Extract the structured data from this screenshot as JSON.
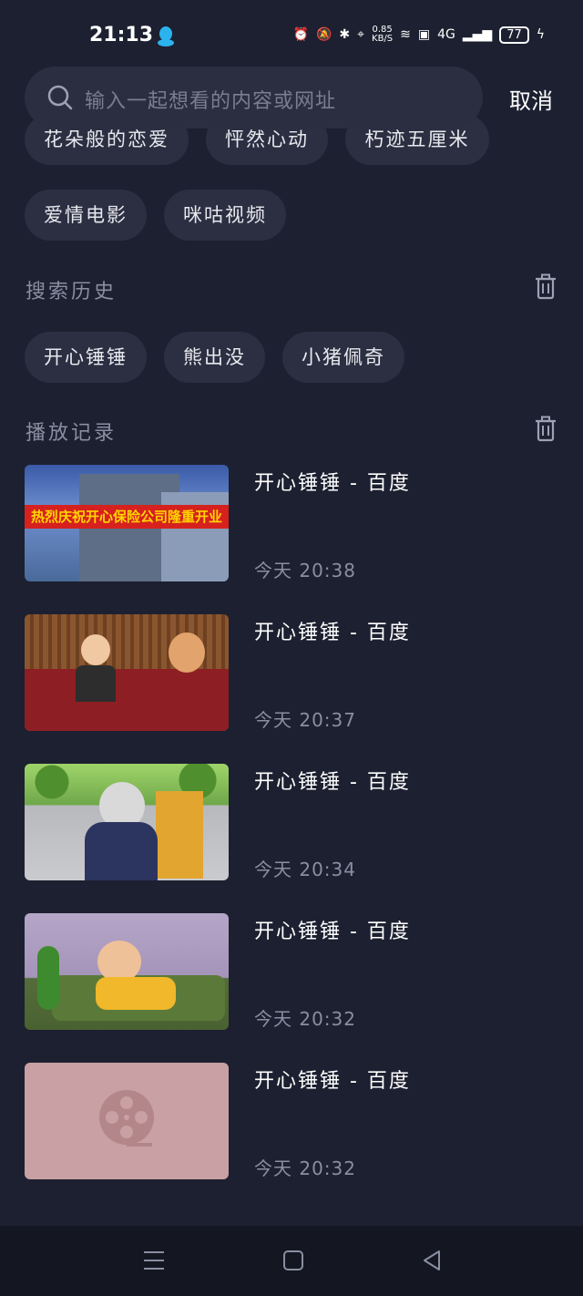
{
  "status_bar": {
    "time": "21:13",
    "net_speed_value": "0.85",
    "net_speed_unit": "KB/S",
    "signal_label": "4G",
    "battery": "77"
  },
  "search": {
    "placeholder": "输入一起想看的内容或网址",
    "cancel_label": "取消"
  },
  "suggestions": [
    "花朵般的恋爱",
    "怦然心动",
    "朽迹五厘米",
    "爱情电影",
    "咪咕视频"
  ],
  "search_history": {
    "title": "搜索历史",
    "items": [
      "开心锤锤",
      "熊出没",
      "小猪佩奇"
    ]
  },
  "play_history": {
    "title": "播放记录",
    "items": [
      {
        "title": "开心锤锤 - 百度",
        "time": "今天 20:38",
        "overlay_text": "热烈庆祝开心保险公司隆重开业"
      },
      {
        "title": "开心锤锤 - 百度",
        "time": "今天 20:37",
        "overlay_text": ""
      },
      {
        "title": "开心锤锤 - 百度",
        "time": "今天 20:34",
        "overlay_text": ""
      },
      {
        "title": "开心锤锤 - 百度",
        "time": "今天 20:32",
        "overlay_text": ""
      },
      {
        "title": "开心锤锤 - 百度",
        "time": "今天 20:32",
        "overlay_text": ""
      }
    ]
  },
  "colors": {
    "background": "#1d2030",
    "chip": "#2c2f42",
    "placeholder_thumb": "#c9a0a3"
  }
}
